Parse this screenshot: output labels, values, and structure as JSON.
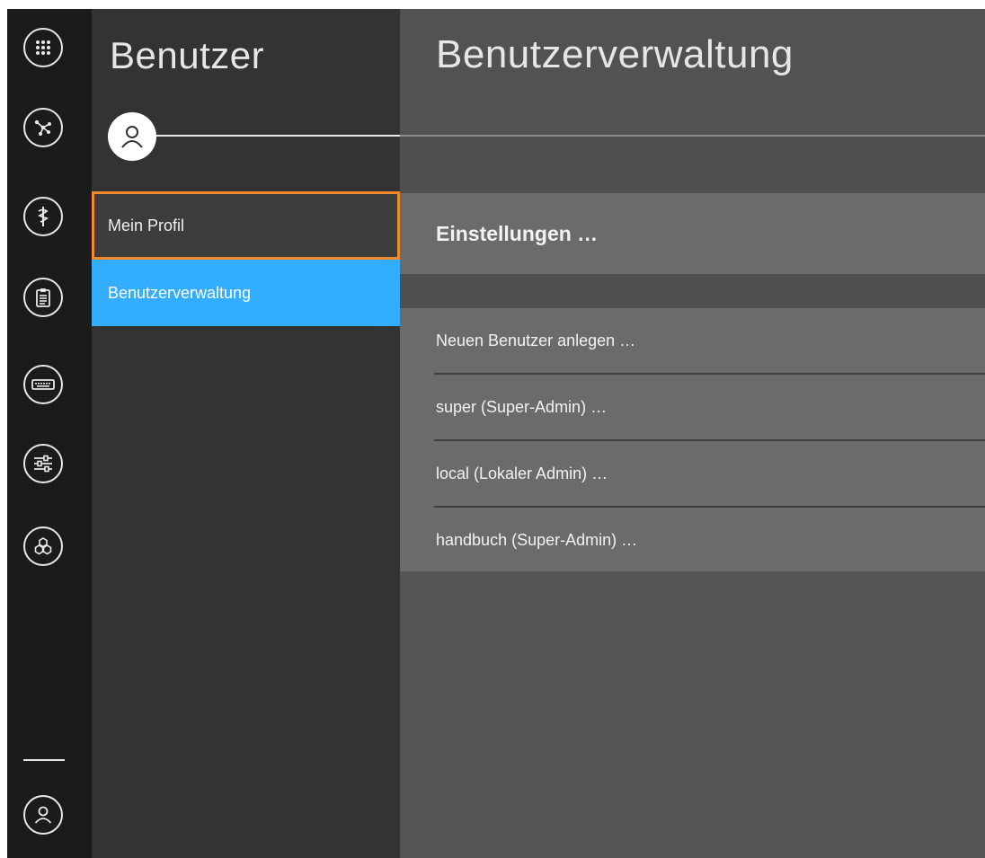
{
  "rail": {
    "icons": [
      "apps-grid-icon",
      "network-nodes-icon",
      "staff-icon",
      "clipboard-icon",
      "keyboard-icon",
      "sliders-icon",
      "hexagons-icon",
      "user-icon"
    ]
  },
  "sidebar": {
    "title": "Benutzer",
    "items": [
      {
        "label": "Mein Profil",
        "state": "focused"
      },
      {
        "label": "Benutzerverwaltung",
        "state": "selected"
      }
    ]
  },
  "main": {
    "title": "Benutzerverwaltung",
    "settings_label": "Einstellungen …",
    "users": [
      {
        "label": "Neuen Benutzer anlegen …"
      },
      {
        "label": "super (Super-Admin) …"
      },
      {
        "label": "local (Lokaler Admin) …"
      },
      {
        "label": "handbuch (Super-Admin) …"
      }
    ]
  },
  "colors": {
    "accent_selected": "#33adff",
    "focus_outline": "#f08a2c",
    "rail_background": "#1b1b1b",
    "sidebar_background": "#333333",
    "main_background": "#575757"
  }
}
